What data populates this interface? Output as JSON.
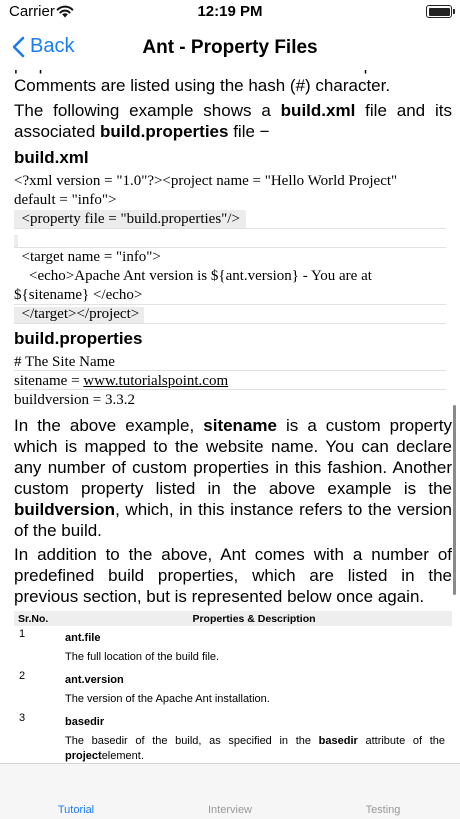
{
  "status_bar": {
    "carrier": "Carrier",
    "time": "12:19 PM"
  },
  "nav": {
    "back_label": "Back",
    "title": "Ant - Property Files"
  },
  "content": {
    "p1": "Comments are listed using the hash (#) character.",
    "p2": {
      "t1": "The following example shows a ",
      "b1": "build.xml",
      "t2": " file and its associated ",
      "b2": "build.properties",
      "t3": " file −"
    },
    "h_build_xml": "build.xml",
    "code_xml": [
      "<?xml version = \"1.0\"?><project name = \"Hello World Project\"",
      "default = \"info\">",
      "  <property file = \"build.properties\"/>",
      "",
      "  <target name = \"info\">",
      "    <echo>Apache Ant version is ${ant.version} - You are at",
      "${sitename} </echo>",
      "  </target></project>"
    ],
    "h_build_props": "build.properties",
    "props": {
      "comment": "# The Site Name",
      "sitename_key": "sitename = ",
      "sitename_val": "www.tutorialspoint.com",
      "buildversion": "buildversion = 3.3.2"
    },
    "p3": {
      "t1": "In the above example, ",
      "b1": "sitename",
      "t2": " is a custom property which is mapped to the website name. You can declare any number of custom properties in this fashion. Another custom property listed in the above example is the ",
      "b2": "buildversion",
      "t3": ", which, in this instance refers to the version of the build."
    },
    "p4": "In addition to the above, Ant comes with a number of predefined build properties, which are listed in the previous section, but is represented below once again."
  },
  "table": {
    "headers": [
      "Sr.No.",
      "Properties & Description"
    ],
    "rows": [
      {
        "n": "1",
        "name": "ant.file",
        "desc": "The full location of the build file."
      },
      {
        "n": "2",
        "name": "ant.version",
        "desc": "The version of the Apache Ant installation."
      },
      {
        "n": "3",
        "name": "basedir",
        "desc_t1": "The basedir of the build, as specified in the ",
        "desc_b1": "basedir",
        "desc_t2": " attribute of the ",
        "desc_b2": "project",
        "desc_t3": "element."
      }
    ]
  },
  "tabs": [
    {
      "label": "Tutorial",
      "active": true
    },
    {
      "label": "Interview",
      "active": false
    },
    {
      "label": "Testing",
      "active": false
    }
  ],
  "colors": {
    "accent": "#1a7cf7",
    "inactive_tab": "#999999"
  }
}
